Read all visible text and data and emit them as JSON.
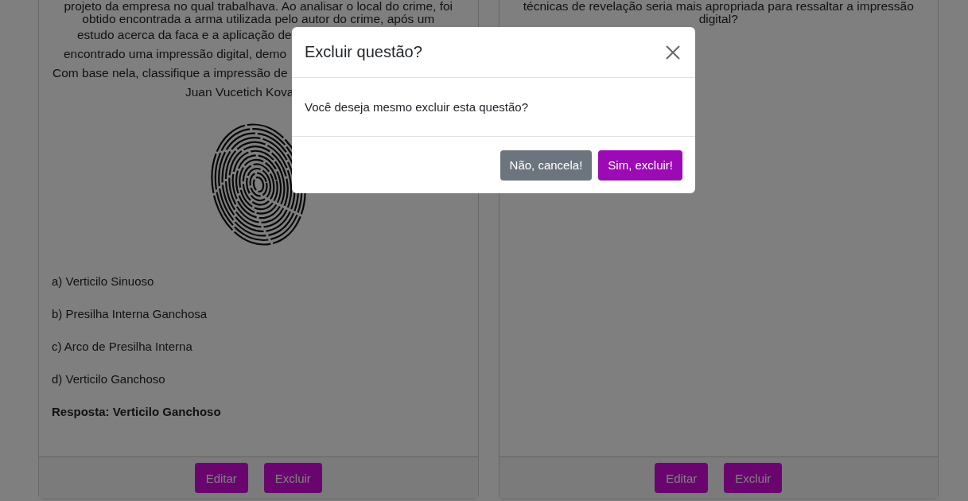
{
  "cards": [
    {
      "question_lines": [
        {
          "text": "projeto da empresa no qual trabalhava. Ao analisar o local do crime, foi",
          "covered": false
        },
        {
          "text": "obtido encontrada a arma utilizada pelo autor do crime, após um",
          "covered": false
        },
        {
          "text": "estudo acerca da faca e a aplicação de",
          "covered": true
        },
        {
          "text": "encontrado uma impressão digital, demo",
          "covered": true
        },
        {
          "text": "Com base nela, classifique a impressão de",
          "covered": true
        },
        {
          "text": "Juan Vucetich Kova",
          "covered": true
        }
      ],
      "has_image": true,
      "options": [
        "a) Verticilo Sinuoso",
        "b) Presilha Interna Ganchosa",
        "c) Arco de Presilha Interna",
        "d) Verticilo Ganchoso"
      ],
      "answer": "Resposta: Verticilo Ganchoso",
      "buttons": [
        {
          "label": "Editar"
        },
        {
          "label": "Excluir"
        }
      ]
    },
    {
      "question_lines": [
        {
          "text": "técnicas de revelação seria mais apropriada para ressaltar a impressão",
          "covered": false
        },
        {
          "text": "digital?",
          "covered": false
        }
      ],
      "has_image": false,
      "buttons": [
        {
          "label": "Editar"
        },
        {
          "label": "Excluir"
        }
      ]
    }
  ],
  "modal": {
    "title": "Excluir questão?",
    "message": "Você deseja mesmo excluir esta questão?",
    "buttons": [
      {
        "label": "Não, cancela!",
        "kind": "secondary"
      },
      {
        "label": "Sim, excluir!",
        "kind": "primary"
      }
    ]
  }
}
